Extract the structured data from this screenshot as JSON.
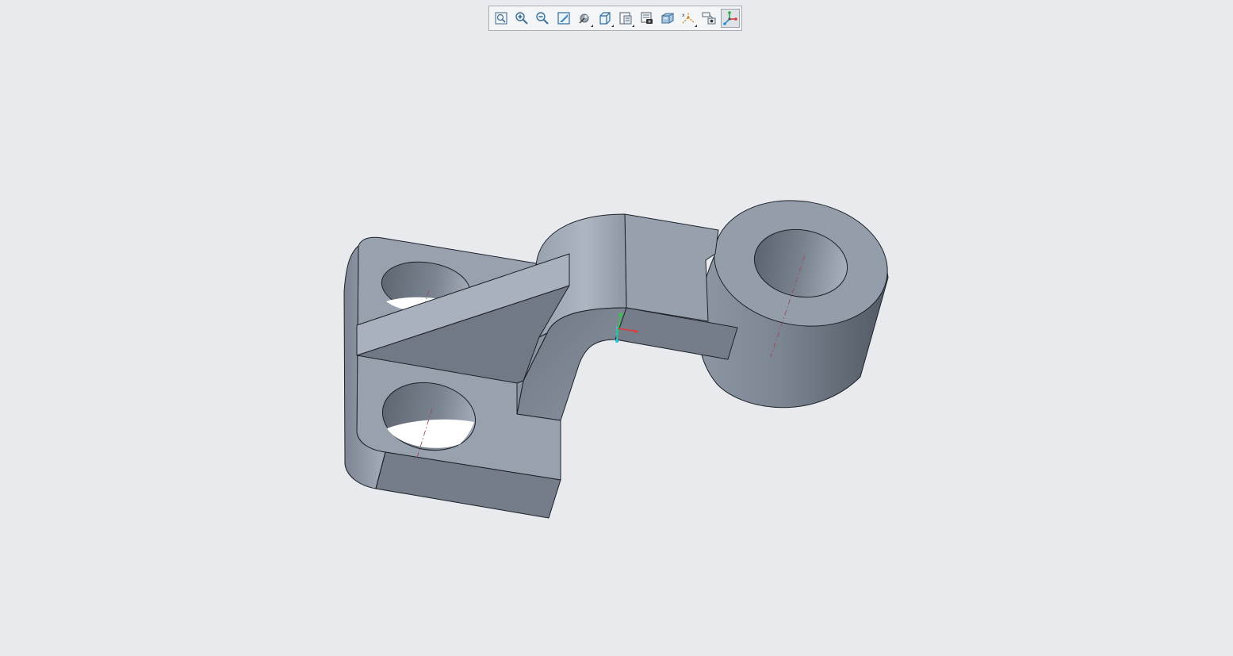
{
  "toolbar": {
    "buttons": [
      {
        "name": "refit-button",
        "icon": "refit-icon",
        "active": false
      },
      {
        "name": "zoom-in-button",
        "icon": "zoom-in-icon",
        "active": false
      },
      {
        "name": "zoom-out-button",
        "icon": "zoom-out-icon",
        "active": false
      },
      {
        "name": "repaint-button",
        "icon": "repaint-icon",
        "active": false
      },
      {
        "name": "display-style-button",
        "icon": "display-style-icon",
        "active": false,
        "flyout": true
      },
      {
        "name": "saved-orientations-button",
        "icon": "saved-orientations-icon",
        "active": false,
        "flyout": true
      },
      {
        "name": "view-manager-button",
        "icon": "view-manager-icon",
        "active": false,
        "flyout": true
      },
      {
        "name": "perspective-view-button",
        "icon": "perspective-view-icon",
        "active": false
      },
      {
        "name": "section-view-button",
        "icon": "section-view-icon",
        "active": false
      },
      {
        "name": "datum-display-filters-button",
        "icon": "datum-display-filters-icon",
        "active": false,
        "flyout": true
      },
      {
        "name": "annotation-display-button",
        "icon": "annotation-display-icon",
        "active": false
      },
      {
        "name": "spin-center-button",
        "icon": "spin-center-icon",
        "active": true
      }
    ]
  },
  "colors": {
    "background": "#e9eaed",
    "part_light": "#a3adba",
    "part_mid": "#929caa",
    "part_dark": "#6f7884",
    "part_shadow": "#56606b",
    "edge": "#1d2128",
    "axis_line": "#9a4a5a",
    "csys_x": "#e03a3a",
    "csys_y": "#2ecc40",
    "csys_z": "#1fc8e0"
  }
}
